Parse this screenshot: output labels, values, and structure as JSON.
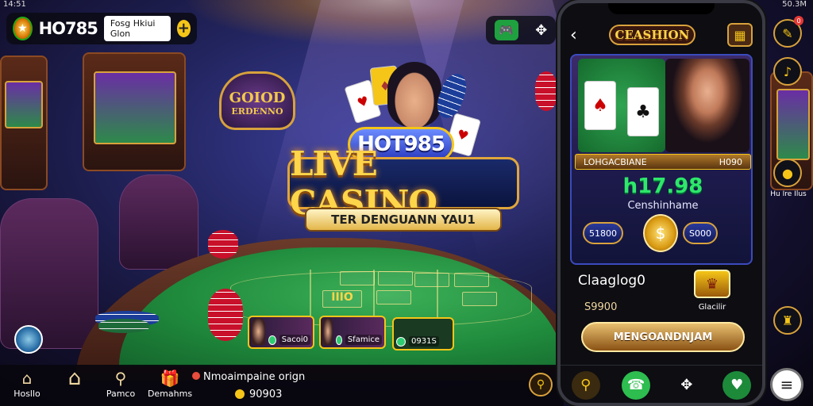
{
  "status_bar": {
    "left": "14:51",
    "right": "50.3M"
  },
  "header": {
    "brand": "HO785",
    "promo_text": "Fosg Hkiui Glon",
    "add_label": "+"
  },
  "hero": {
    "badge_line1": "GOIOD",
    "badge_line2": "ERDENNO",
    "brand_badge": "HOT985",
    "title": "LIVE CASINO",
    "tagline": "TER DENGUANN YAU1"
  },
  "table": {
    "dealers": [
      {
        "label": "Sacoi0"
      },
      {
        "label": "Sfamice"
      },
      {
        "label": "0931S"
      }
    ],
    "felt_labels": [
      "IIIO"
    ]
  },
  "bottom_nav": {
    "items": [
      {
        "label": "Hosllo",
        "icon": "home-group-icon"
      },
      {
        "label": "",
        "icon": "home-icon"
      },
      {
        "label": "Pamco",
        "icon": "search-icon"
      },
      {
        "label": "Demahms",
        "icon": "gift-icon"
      }
    ],
    "notice": "Nmoaimpaine orign",
    "balance": "90903"
  },
  "phone": {
    "logo": "CEASHION",
    "info_left": "LOHGACBIANE",
    "info_right": "H090",
    "big_number": "h17.98",
    "subtitle": "Censhinhame",
    "chip_left": "51800",
    "chip_right": "S000",
    "row_title": "Claaglog0",
    "row_value": "S9900",
    "reward_label": "Glacilir",
    "cta": "MENGOANDNJAM"
  },
  "right_rail": {
    "label": "Hu Ire Ilus",
    "badge_count": "0"
  }
}
